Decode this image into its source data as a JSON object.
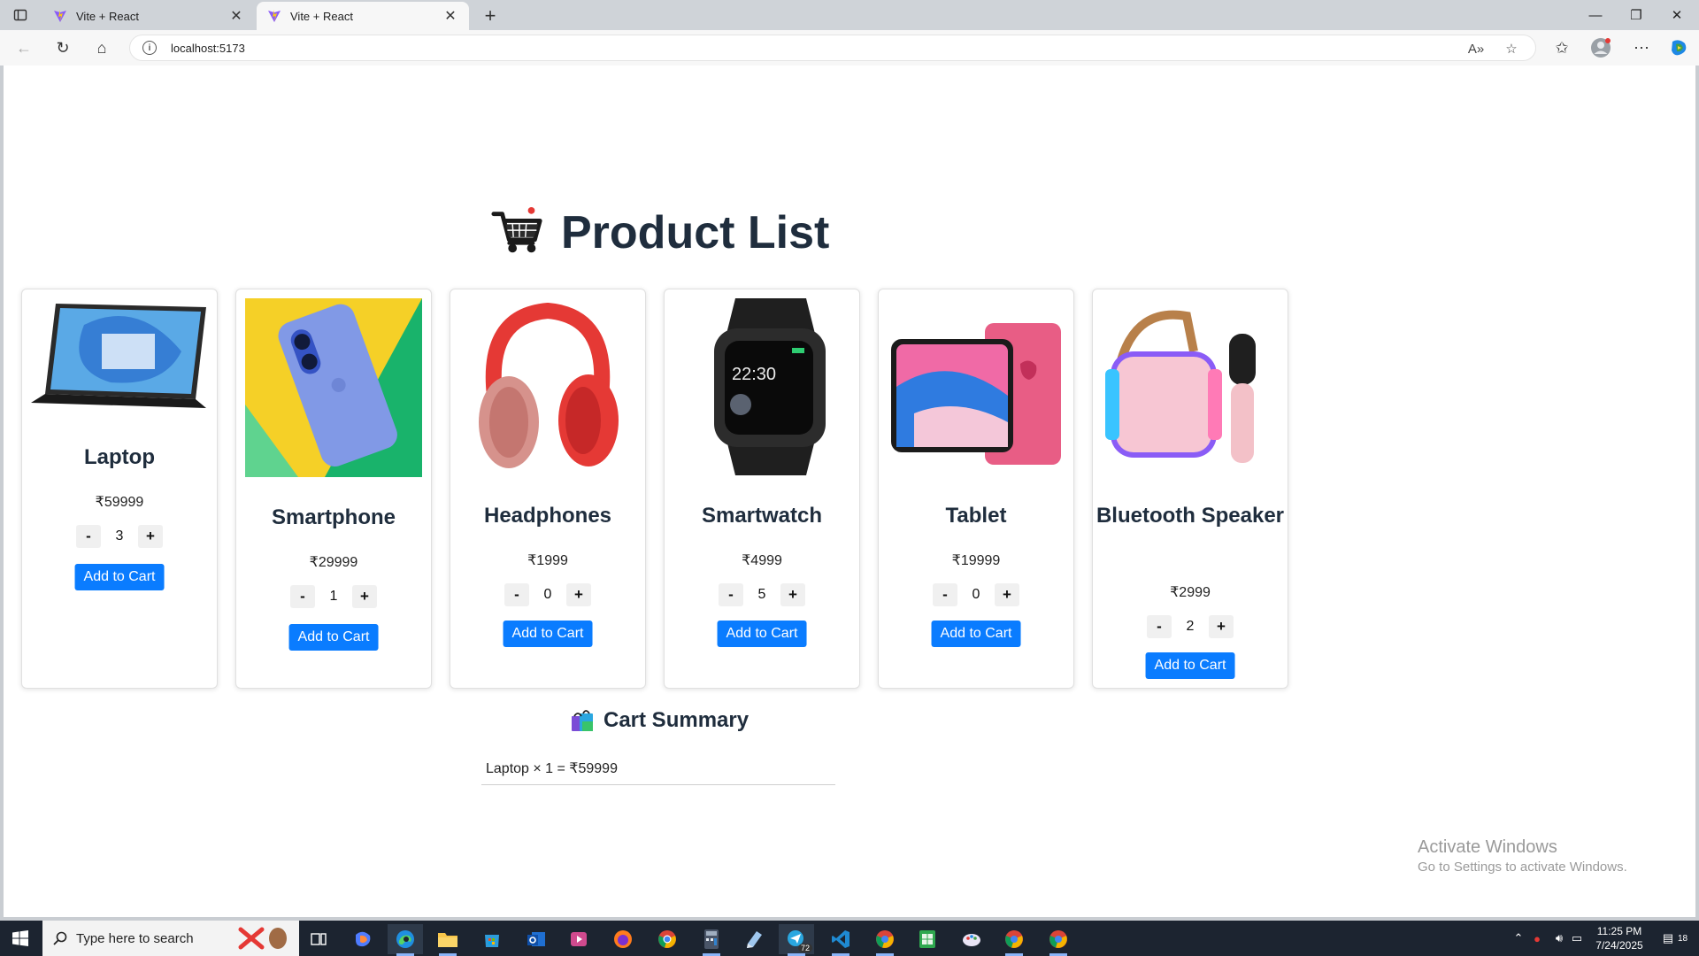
{
  "browser": {
    "tabs": [
      {
        "title": "Vite + React",
        "active": false
      },
      {
        "title": "Vite + React",
        "active": true
      }
    ],
    "url": "localhost:5173"
  },
  "page": {
    "heading": "Product List",
    "products": [
      {
        "name": "Laptop",
        "price": "₹59999",
        "qty": "3",
        "add_label": "Add to Cart",
        "minus": "-",
        "plus": "+"
      },
      {
        "name": "Smartphone",
        "price": "₹29999",
        "qty": "1",
        "add_label": "Add to Cart",
        "minus": "-",
        "plus": "+"
      },
      {
        "name": "Headphones",
        "price": "₹1999",
        "qty": "0",
        "add_label": "Add to Cart",
        "minus": "-",
        "plus": "+"
      },
      {
        "name": "Smartwatch",
        "price": "₹4999",
        "qty": "5",
        "add_label": "Add to Cart",
        "minus": "-",
        "plus": "+"
      },
      {
        "name": "Tablet",
        "price": "₹19999",
        "qty": "0",
        "add_label": "Add to Cart",
        "minus": "-",
        "plus": "+"
      },
      {
        "name": "Bluetooth Speaker",
        "price": "₹2999",
        "qty": "2",
        "add_label": "Add to Cart",
        "minus": "-",
        "plus": "+"
      }
    ],
    "cart_summary": {
      "title": "Cart Summary",
      "items": [
        "Laptop × 1 = ₹59999"
      ]
    }
  },
  "watermark": {
    "line1": "Activate Windows",
    "line2": "Go to Settings to activate Windows."
  },
  "taskbar": {
    "search_placeholder": "Type here to search",
    "badge": "72",
    "time": "11:25 PM",
    "date": "7/24/2025",
    "notification_count": "18"
  },
  "colors": {
    "accent_button": "#0a7cff",
    "heading_text": "#1f2d3d"
  }
}
